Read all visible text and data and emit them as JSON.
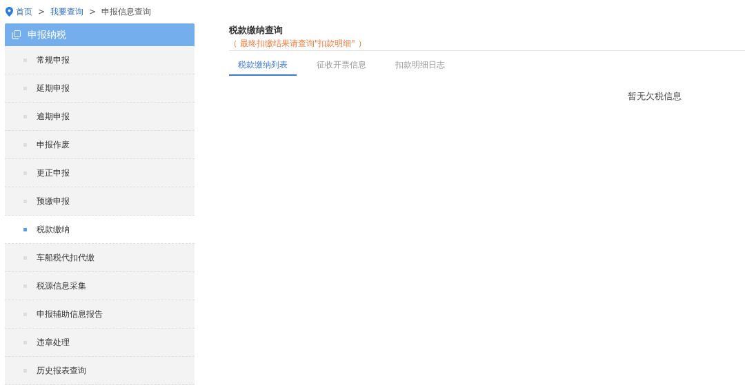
{
  "breadcrumb": [
    {
      "text": "首页",
      "link": true
    },
    {
      "text": ">",
      "link": false
    },
    {
      "text": "我要查询",
      "link": true
    },
    {
      "text": ">",
      "link": false
    },
    {
      "text": "申报信息查询",
      "link": false
    }
  ],
  "sidebar": {
    "title": "申报纳税",
    "items": [
      {
        "label": "常规申报",
        "selected": false
      },
      {
        "label": "延期申报",
        "selected": false
      },
      {
        "label": "逾期申报",
        "selected": false
      },
      {
        "label": "申报作废",
        "selected": false
      },
      {
        "label": "更正申报",
        "selected": false
      },
      {
        "label": "预缴申报",
        "selected": false
      },
      {
        "label": "税款缴纳",
        "selected": true
      },
      {
        "label": "车船税代扣代缴",
        "selected": false
      },
      {
        "label": "税源信息采集",
        "selected": false
      },
      {
        "label": "申报辅助信息报告",
        "selected": false
      },
      {
        "label": "违章处理",
        "selected": false
      },
      {
        "label": "历史报表查询",
        "selected": false
      }
    ]
  },
  "main": {
    "title": "税款缴纳查询",
    "note": "（ 最终扣缴结果请查询\"扣款明细\" ）",
    "tabs": [
      {
        "label": "税款缴纳列表",
        "selected": true
      },
      {
        "label": "征收开票信息",
        "selected": false
      },
      {
        "label": "扣款明细日志",
        "selected": false
      }
    ],
    "empty_message": "暂无欠税信息"
  }
}
